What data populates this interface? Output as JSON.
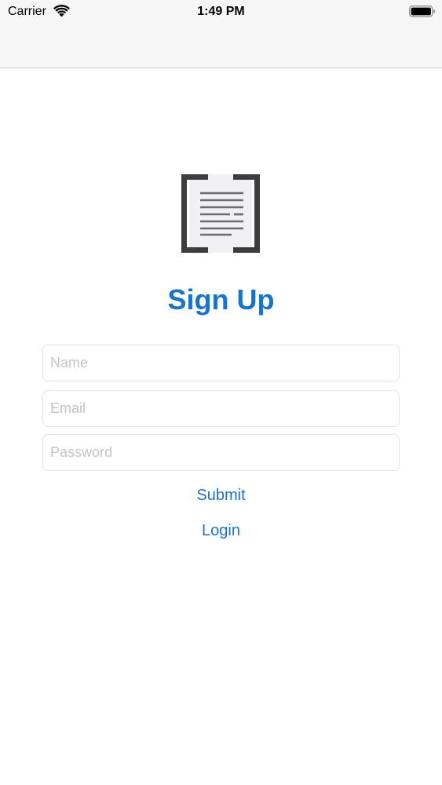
{
  "status_bar": {
    "carrier": "Carrier",
    "time": "1:49 PM",
    "wifi_icon": "wifi-icon",
    "battery_icon": "battery-icon"
  },
  "logo": {
    "icon": "document-brackets-icon",
    "bracket_color": "#3d3d40",
    "page_color": "#f1f1f3",
    "line_color": "#6b6b70"
  },
  "title": "Sign Up",
  "form": {
    "name_placeholder": "Name",
    "name_value": "",
    "email_placeholder": "Email",
    "email_value": "",
    "password_placeholder": "Password",
    "password_value": ""
  },
  "actions": {
    "submit_label": "Submit",
    "login_label": "Login"
  },
  "colors": {
    "accent": "#1a73c9",
    "placeholder": "#c4c4c8",
    "field_border": "#e3e3e6",
    "nav_background": "#f7f7f7"
  }
}
